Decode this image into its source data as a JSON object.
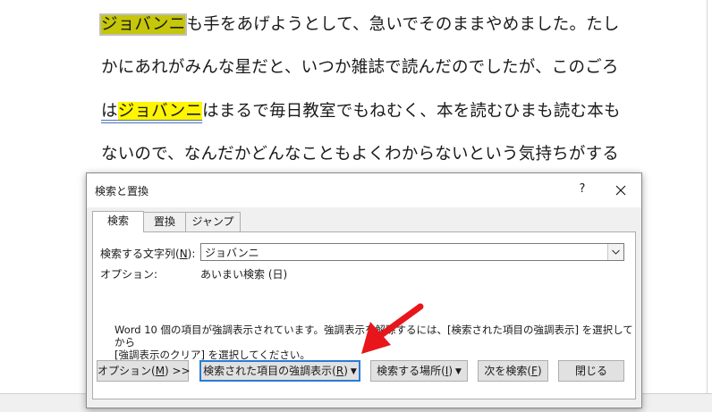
{
  "document": {
    "line1": {
      "highlight_current": "ジョバンニ",
      "rest": "も手をあげようとして、急いでそのままやめました。たし"
    },
    "line2": "かにあれがみんな星だと、いつか雑誌で読んだのでしたが、このごろ",
    "line3": {
      "pre": "は",
      "highlight": "ジョバンニ",
      "rest": "はまるで毎日教室でもねむく、本を読むひまも読む本も"
    },
    "line4": "ないので、なんだかどんなこともよくわからないという気持ちがする"
  },
  "dialog": {
    "title": "検索と置換",
    "help_label": "?",
    "tabs": [
      {
        "label": "検索",
        "active": true
      },
      {
        "label": "置換",
        "active": false
      },
      {
        "label": "ジャンプ",
        "active": false
      }
    ],
    "find_label_pre": "検索する文字列(",
    "find_label_key": "N",
    "find_label_post": "):",
    "find_value": "ジョバンニ",
    "options_label": "オプション:",
    "options_value": "あいまい検索 (日)",
    "info_line1": "Word 10 個の項目が強調表示されています。強調表示を解除するには、[検索された項目の強調表示] を選択してから",
    "info_line2": "[強調表示のクリア] を選択してください。",
    "buttons": {
      "options": {
        "pre": "オプション(",
        "key": "M",
        "post": ") >>"
      },
      "highlight": {
        "pre": "検索された項目の強調表示(",
        "key": "R",
        "post": ")"
      },
      "find_in": {
        "pre": "検索する場所(",
        "key": "I",
        "post": ")"
      },
      "find_next": {
        "pre": "次を検索(",
        "key": "F",
        "post": ")"
      },
      "close": "閉じる"
    }
  },
  "colors": {
    "highlight_yellow": "#fff500",
    "current_match": "#c6c60a",
    "focus_blue": "#2a7bd8",
    "arrow_red": "#e8161b"
  },
  "icons": {
    "close": "close-icon",
    "dropdown": "chevron-down-icon",
    "arrow": "red-arrow-annotation"
  }
}
